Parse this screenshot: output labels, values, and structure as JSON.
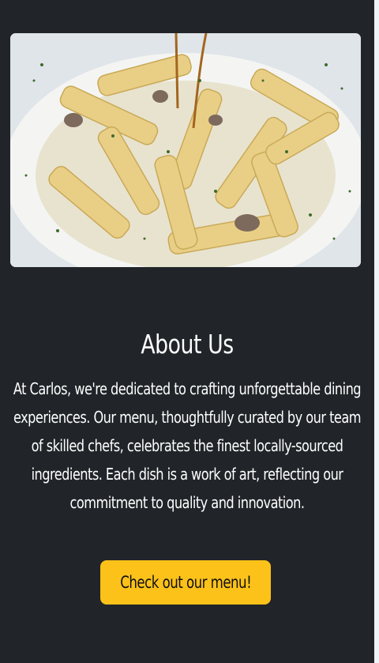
{
  "about": {
    "title": "About Us",
    "body": "At Carlos, we're dedicated to crafting unforgettable dining experiences. Our menu, thoughtfully curated by our team of skilled chefs, celebrates the finest locally-sourced ingredients. Each dish is a work of art, reflecting our commitment to quality and innovation.",
    "cta_label": "Check out our menu!"
  },
  "colors": {
    "background": "#212529",
    "accent": "#fcc21a",
    "text": "#ffffff"
  },
  "image": {
    "subject": "penne-pasta-dish"
  }
}
